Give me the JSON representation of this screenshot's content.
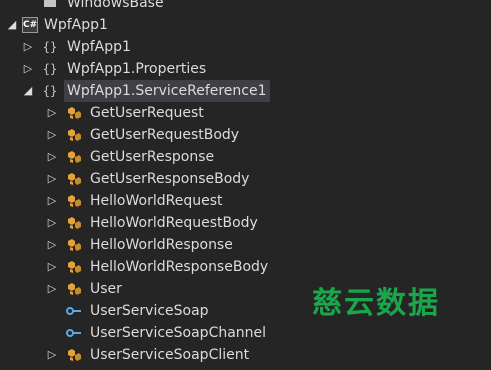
{
  "tree": {
    "top_item": "WindowsBase",
    "project": "WpfApp1",
    "namespaces": [
      {
        "label": "WpfApp1"
      },
      {
        "label": "WpfApp1.Properties"
      },
      {
        "label": "WpfApp1.ServiceReference1"
      }
    ],
    "classes": [
      {
        "label": "GetUserRequest",
        "kind": "class"
      },
      {
        "label": "GetUserRequestBody",
        "kind": "class"
      },
      {
        "label": "GetUserResponse",
        "kind": "class"
      },
      {
        "label": "GetUserResponseBody",
        "kind": "class"
      },
      {
        "label": "HelloWorldRequest",
        "kind": "class"
      },
      {
        "label": "HelloWorldRequestBody",
        "kind": "class"
      },
      {
        "label": "HelloWorldResponse",
        "kind": "class"
      },
      {
        "label": "HelloWorldResponseBody",
        "kind": "class"
      },
      {
        "label": "User",
        "kind": "class"
      },
      {
        "label": "UserServiceSoap",
        "kind": "interface"
      },
      {
        "label": "UserServiceSoapChannel",
        "kind": "interface"
      },
      {
        "label": "UserServiceSoapClient",
        "kind": "class"
      }
    ]
  },
  "watermark": "慈云数据",
  "colors": {
    "background": "#252526",
    "selection": "#3f3f46",
    "class_icon": "#e8a23a",
    "interface_icon": "#5aa9e6",
    "watermark": "#1aa64b"
  }
}
